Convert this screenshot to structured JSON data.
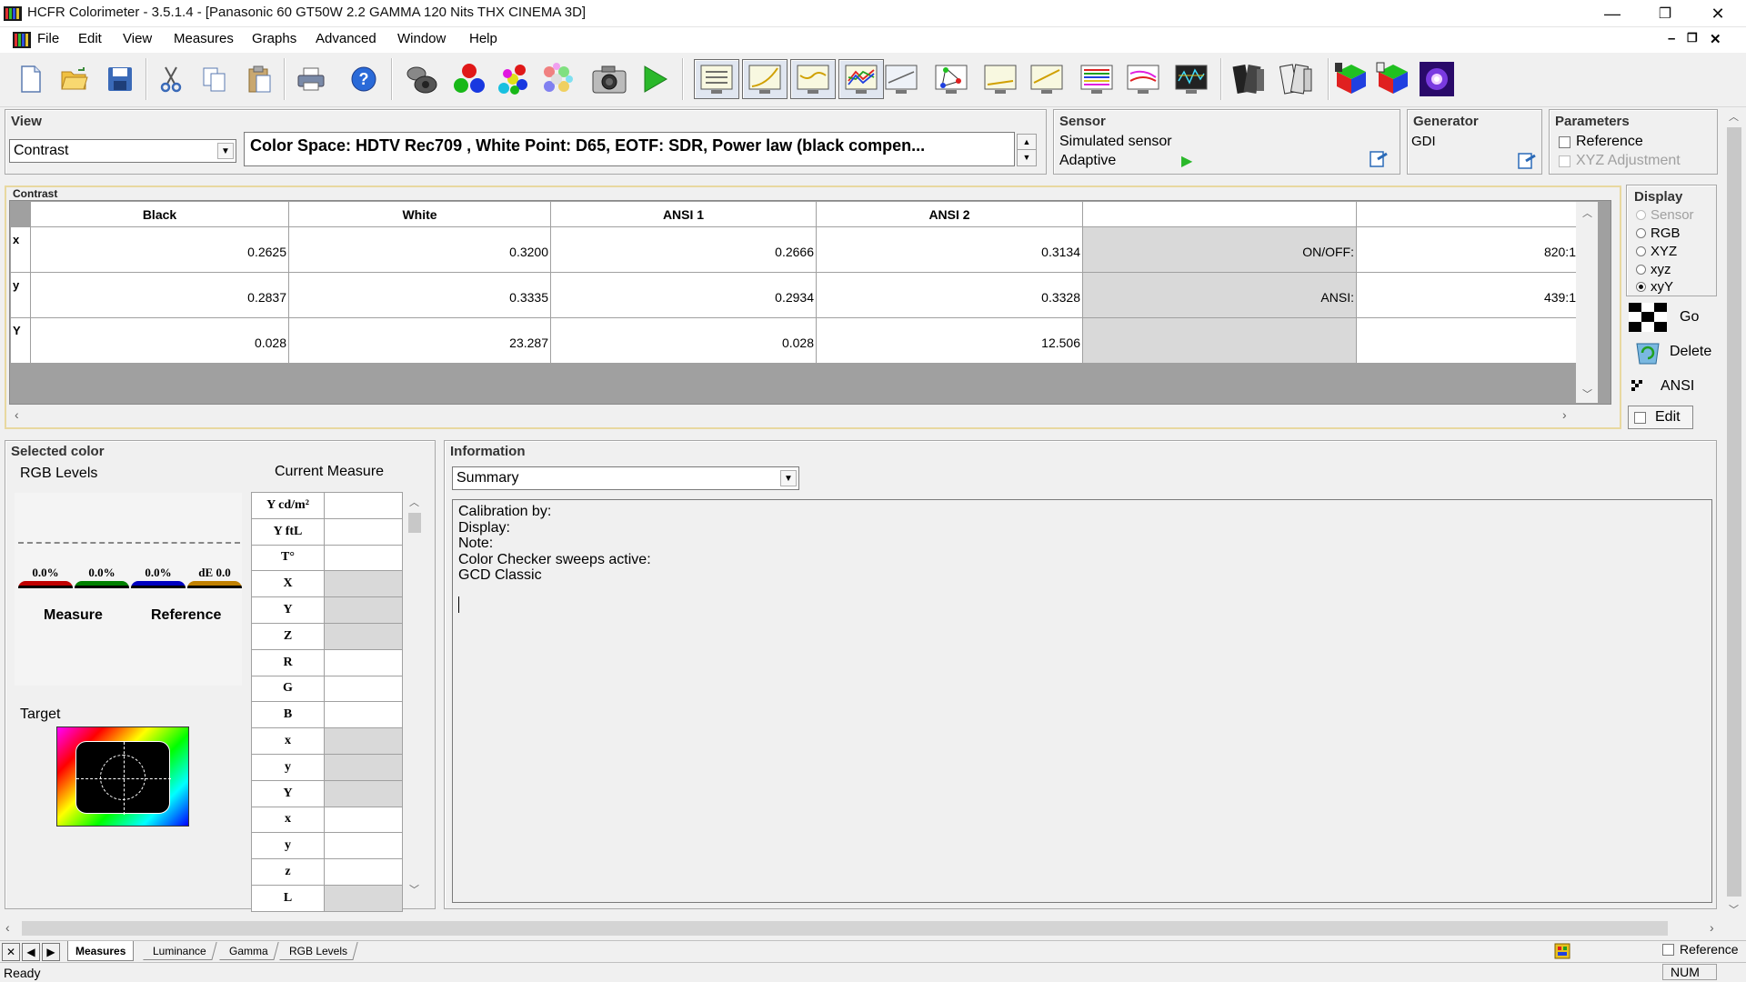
{
  "window": {
    "title": "HCFR Colorimeter - 3.5.1.4 - [Panasonic 60 GT50W 2.2 GAMMA 120 Nits THX CINEMA 3D]",
    "minimize_glyph": "—",
    "restore_glyph": "❐",
    "close_glyph": "✕",
    "mdi_min": "–",
    "mdi_restore": "❐",
    "mdi_close": "✕"
  },
  "menu": [
    "File",
    "Edit",
    "View",
    "Measures",
    "Graphs",
    "Advanced",
    "Window",
    "Help"
  ],
  "toolbar": {
    "icons": [
      "new-icon",
      "open-icon",
      "save-icon",
      "cut-icon",
      "copy-icon",
      "paste-icon",
      "print-icon",
      "help-icon",
      "sensor-icon",
      "rgb-measure-icon",
      "secondary-measure-icon",
      "saturation-measure-icon",
      "camera-icon",
      "play-icon",
      "view-measures-icon",
      "view-luminance-icon",
      "view-gamma-icon",
      "view-rgb-levels-icon",
      "view-color-temp-icon",
      "view-cie-icon",
      "view-near-black-icon",
      "view-near-white-icon",
      "view-saturation-shift-icon",
      "view-saturation-lum-icon",
      "view-colorchecker-icon",
      "film-icon",
      "film-edit-icon",
      "cube-icon",
      "cube-edit-icon",
      "galaxy-icon"
    ],
    "pressed": [
      "view-measures-icon",
      "view-luminance-icon",
      "view-gamma-icon",
      "view-rgb-levels-icon"
    ]
  },
  "view_panel": {
    "title": "View",
    "selected": "Contrast",
    "info": "Color Space: HDTV Rec709 , White Point: D65, EOTF:  SDR, Power law (black compen..."
  },
  "sensor_panel": {
    "title": "Sensor",
    "sensor": "Simulated sensor",
    "mode": "Adaptive"
  },
  "generator_panel": {
    "title": "Generator",
    "name": "GDI"
  },
  "parameters_panel": {
    "title": "Parameters",
    "reference": "Reference",
    "xyz_adjust": "XYZ Adjustment"
  },
  "contrast": {
    "label": "Contrast",
    "columns": [
      "Black",
      "White",
      "ANSI 1",
      "ANSI 2",
      "",
      ""
    ],
    "rows": [
      {
        "head": "x",
        "values": [
          "0.2625",
          "0.3200",
          "0.2666",
          "0.3134"
        ],
        "label": "ON/OFF:",
        "result": "820:1"
      },
      {
        "head": "y",
        "values": [
          "0.2837",
          "0.3335",
          "0.2934",
          "0.3328"
        ],
        "label": "ANSI:",
        "result": "439:1"
      },
      {
        "head": "Y",
        "values": [
          "0.028",
          "23.287",
          "0.028",
          "12.506"
        ],
        "label": "",
        "result": ""
      }
    ]
  },
  "display_panel": {
    "title": "Display",
    "options": [
      {
        "label": "Sensor",
        "disabled": true,
        "selected": false
      },
      {
        "label": "RGB",
        "disabled": false,
        "selected": false
      },
      {
        "label": "XYZ",
        "disabled": false,
        "selected": false
      },
      {
        "label": "xyz",
        "disabled": false,
        "selected": false
      },
      {
        "label": "xyY",
        "disabled": false,
        "selected": true
      }
    ],
    "go": "Go",
    "delete": "Delete",
    "ansi": "ANSI",
    "edit": "Edit"
  },
  "selected_color": {
    "title": "Selected color",
    "rgb_levels": "RGB Levels",
    "current_measure": "Current Measure",
    "bars": [
      {
        "label": "0.0%",
        "color": "#c00000"
      },
      {
        "label": "0.0%",
        "color": "#008000"
      },
      {
        "label": "0.0%",
        "color": "#0000c0"
      },
      {
        "label": "dE 0.0",
        "color": "#c08000"
      }
    ],
    "measure": "Measure",
    "reference": "Reference",
    "target": "Target",
    "measure_rows": [
      "Y cd/m²",
      "Y ftL",
      "T°",
      "X",
      "Y",
      "Z",
      "R",
      "G",
      "B",
      "x",
      "y",
      "Y",
      "x",
      "y",
      "z",
      "L"
    ],
    "grey_rows": [
      3,
      4,
      5,
      9,
      10,
      11,
      15
    ]
  },
  "information": {
    "title": "Information",
    "selected": "Summary",
    "lines": [
      "Calibration by:",
      "Display:",
      "Note:",
      "Color Checker sweeps active:",
      "GCD Classic"
    ]
  },
  "tabs": [
    "Measures",
    "Luminance",
    "Gamma",
    "RGB Levels"
  ],
  "active_tab": "Measures",
  "footer": {
    "reference": "Reference",
    "status": "Ready",
    "num": "NUM"
  }
}
